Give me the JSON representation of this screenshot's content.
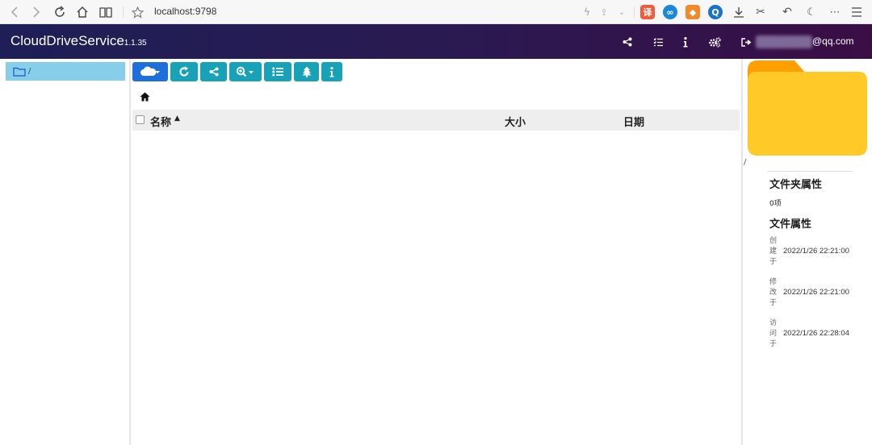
{
  "browser": {
    "url": "localhost:9798",
    "icons": [
      "back-icon",
      "forward-icon",
      "reload-icon",
      "home-icon",
      "reader-icon",
      "star-icon"
    ],
    "extensions": [
      {
        "name": "translate-extension-icon",
        "label": "译",
        "color": "#f25a3c"
      },
      {
        "name": "infinity-extension-icon",
        "label": "∞",
        "color": "#1a87d9"
      },
      {
        "name": "game-extension-icon",
        "label": "◆",
        "color": "#f08a2a"
      },
      {
        "name": "search-extension-icon",
        "label": "Q",
        "color": "#1a73c8"
      }
    ]
  },
  "header": {
    "brand": "CloudDriveService",
    "version": "1.1.35",
    "icons": [
      "share-icon",
      "task-list-icon",
      "info-icon",
      "settings-icon",
      "logout-icon"
    ],
    "user_email": "@qq.com"
  },
  "sidebar": {
    "root_label": "/"
  },
  "toolbar": {
    "buttons": [
      "cloud-upload-icon",
      "refresh-icon",
      "share-icon",
      "search-icon",
      "list-icon",
      "tree-icon",
      "info-icon"
    ]
  },
  "table": {
    "columns": [
      "名称",
      "大小",
      "日期"
    ],
    "sort_caret": "▲",
    "rows": []
  },
  "props": {
    "path": "/",
    "folder_title": "文件夹属性",
    "item_count": "0项",
    "file_title": "文件属性",
    "created_label": "创建于",
    "created_value": "2022/1/26 22:21:00",
    "modified_label": "修改于",
    "modified_value": "2022/1/26 22:21:00",
    "accessed_label": "访问于",
    "accessed_value": "2022/1/26 22:28:04"
  },
  "colors": {
    "accent": "#17a2b8",
    "primary": "#1e6fd9",
    "folder": "#ffca28",
    "folder_back": "#ffa000",
    "selection": "#87ceeb"
  }
}
